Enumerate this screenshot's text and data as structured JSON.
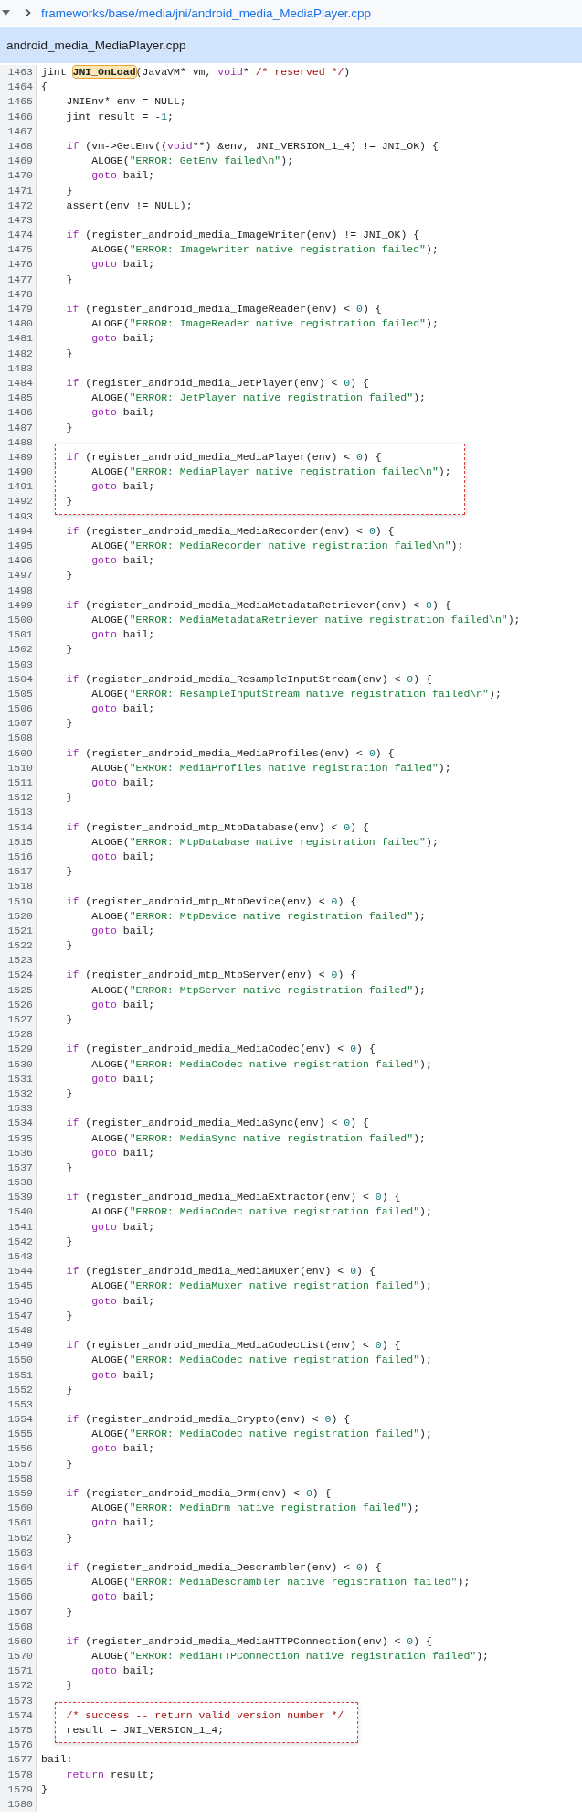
{
  "breadcrumb": {
    "path": "frameworks/base/media/jni/android_media_MediaPlayer.cpp"
  },
  "file_header": {
    "title": "android_media_MediaPlayer.cpp"
  },
  "code": {
    "segments": [
      {
        "kind": "plain",
        "lines": [
          {
            "number": "1463",
            "tokens": [
              {
                "kind": "plain",
                "text": "jint "
              },
              {
                "kind": "highlight",
                "text": "JNI_OnLoad"
              },
              {
                "kind": "plain",
                "text": "(JavaVM* vm, "
              },
              {
                "kind": "keyword",
                "text": "void"
              },
              {
                "kind": "plain",
                "text": "* "
              },
              {
                "kind": "comment",
                "text": "/* reserved */"
              },
              {
                "kind": "plain",
                "text": ")"
              }
            ]
          },
          {
            "number": "1464",
            "tokens": [
              {
                "kind": "plain",
                "text": "{"
              }
            ]
          },
          {
            "number": "1465",
            "tokens": [
              {
                "kind": "plain",
                "text": "    JNIEnv* env = NULL;"
              }
            ]
          },
          {
            "number": "1466",
            "tokens": [
              {
                "kind": "plain",
                "text": "    jint result = -"
              },
              {
                "kind": "number",
                "text": "1"
              },
              {
                "kind": "plain",
                "text": ";"
              }
            ]
          },
          {
            "number": "1467"
          },
          {
            "number": "1468",
            "tokens": [
              {
                "kind": "keyword",
                "text": "    if"
              },
              {
                "kind": "plain",
                "text": " (vm->GetEnv(("
              },
              {
                "kind": "keyword",
                "text": "void"
              },
              {
                "kind": "plain",
                "text": "**) &env, JNI_VERSION_1_4) != JNI_OK) {"
              }
            ]
          },
          {
            "number": "1469",
            "tokens": [
              {
                "kind": "plain",
                "text": "        ALOGE("
              },
              {
                "kind": "string",
                "text": "\"ERROR: GetEnv failed\\n\""
              },
              {
                "kind": "plain",
                "text": ");"
              }
            ]
          },
          {
            "number": "1470",
            "tokens": [
              {
                "kind": "keyword",
                "text": "        goto"
              },
              {
                "kind": "plain",
                "text": " bail;"
              }
            ]
          },
          {
            "number": "1471",
            "tokens": [
              {
                "kind": "plain",
                "text": "    }"
              }
            ]
          },
          {
            "number": "1472",
            "tokens": [
              {
                "kind": "plain",
                "text": "    assert(env != NULL);"
              }
            ]
          },
          {
            "number": "1473"
          },
          {
            "number": "1474",
            "tokens": [
              {
                "kind": "keyword",
                "text": "    if"
              },
              {
                "kind": "plain",
                "text": " (register_android_media_ImageWriter(env) != JNI_OK) {"
              }
            ]
          },
          {
            "number": "1475",
            "tokens": [
              {
                "kind": "plain",
                "text": "        ALOGE("
              },
              {
                "kind": "string",
                "text": "\"ERROR: ImageWriter native registration failed\""
              },
              {
                "kind": "plain",
                "text": ");"
              }
            ]
          },
          {
            "number": "1476",
            "tokens": [
              {
                "kind": "keyword",
                "text": "        goto"
              },
              {
                "kind": "plain",
                "text": " bail;"
              }
            ]
          },
          {
            "number": "1477",
            "tokens": [
              {
                "kind": "plain",
                "text": "    }"
              }
            ]
          },
          {
            "number": "1478"
          },
          {
            "number": "1479",
            "tokens": [
              {
                "kind": "keyword",
                "text": "    if"
              },
              {
                "kind": "plain",
                "text": " (register_android_media_ImageReader(env) < "
              },
              {
                "kind": "number",
                "text": "0"
              },
              {
                "kind": "plain",
                "text": ") {"
              }
            ]
          },
          {
            "number": "1480",
            "tokens": [
              {
                "kind": "plain",
                "text": "        ALOGE("
              },
              {
                "kind": "string",
                "text": "\"ERROR: ImageReader native registration failed\""
              },
              {
                "kind": "plain",
                "text": ");"
              }
            ]
          },
          {
            "number": "1481",
            "tokens": [
              {
                "kind": "keyword",
                "text": "        goto"
              },
              {
                "kind": "plain",
                "text": " bail;"
              }
            ]
          },
          {
            "number": "1482",
            "tokens": [
              {
                "kind": "plain",
                "text": "    }"
              }
            ]
          },
          {
            "number": "1483"
          },
          {
            "number": "1484",
            "tokens": [
              {
                "kind": "keyword",
                "text": "    if"
              },
              {
                "kind": "plain",
                "text": " (register_android_media_JetPlayer(env) < "
              },
              {
                "kind": "number",
                "text": "0"
              },
              {
                "kind": "plain",
                "text": ") {"
              }
            ]
          },
          {
            "number": "1485",
            "tokens": [
              {
                "kind": "plain",
                "text": "        ALOGE("
              },
              {
                "kind": "string",
                "text": "\"ERROR: JetPlayer native registration failed\""
              },
              {
                "kind": "plain",
                "text": ");"
              }
            ]
          },
          {
            "number": "1486",
            "tokens": [
              {
                "kind": "keyword",
                "text": "        goto"
              },
              {
                "kind": "plain",
                "text": " bail;"
              }
            ]
          },
          {
            "number": "1487",
            "tokens": [
              {
                "kind": "plain",
                "text": "    }"
              }
            ]
          },
          {
            "number": "1488"
          }
        ]
      },
      {
        "kind": "boxed",
        "lines": [
          {
            "number": "1489",
            "tokens": [
              {
                "kind": "keyword",
                "text": "    if"
              },
              {
                "kind": "plain",
                "text": " (register_android_media_MediaPlayer(env) < "
              },
              {
                "kind": "number",
                "text": "0"
              },
              {
                "kind": "plain",
                "text": ") {"
              }
            ]
          },
          {
            "number": "1490",
            "tokens": [
              {
                "kind": "plain",
                "text": "        ALOGE("
              },
              {
                "kind": "string",
                "text": "\"ERROR: MediaPlayer native registration failed\\n\""
              },
              {
                "kind": "plain",
                "text": ");"
              }
            ]
          },
          {
            "number": "1491",
            "tokens": [
              {
                "kind": "keyword",
                "text": "        goto"
              },
              {
                "kind": "plain",
                "text": " bail;"
              }
            ]
          },
          {
            "number": "1492",
            "tokens": [
              {
                "kind": "plain",
                "text": "    }"
              }
            ]
          }
        ]
      },
      {
        "kind": "plain",
        "lines": [
          {
            "number": "1493"
          },
          {
            "number": "1494",
            "tokens": [
              {
                "kind": "keyword",
                "text": "    if"
              },
              {
                "kind": "plain",
                "text": " (register_android_media_MediaRecorder(env) < "
              },
              {
                "kind": "number",
                "text": "0"
              },
              {
                "kind": "plain",
                "text": ") {"
              }
            ]
          },
          {
            "number": "1495",
            "tokens": [
              {
                "kind": "plain",
                "text": "        ALOGE("
              },
              {
                "kind": "string",
                "text": "\"ERROR: MediaRecorder native registration failed\\n\""
              },
              {
                "kind": "plain",
                "text": ");"
              }
            ]
          },
          {
            "number": "1496",
            "tokens": [
              {
                "kind": "keyword",
                "text": "        goto"
              },
              {
                "kind": "plain",
                "text": " bail;"
              }
            ]
          },
          {
            "number": "1497",
            "tokens": [
              {
                "kind": "plain",
                "text": "    }"
              }
            ]
          },
          {
            "number": "1498"
          },
          {
            "number": "1499",
            "tokens": [
              {
                "kind": "keyword",
                "text": "    if"
              },
              {
                "kind": "plain",
                "text": " (register_android_media_MediaMetadataRetriever(env) < "
              },
              {
                "kind": "number",
                "text": "0"
              },
              {
                "kind": "plain",
                "text": ") {"
              }
            ]
          },
          {
            "number": "1500",
            "tokens": [
              {
                "kind": "plain",
                "text": "        ALOGE("
              },
              {
                "kind": "string",
                "text": "\"ERROR: MediaMetadataRetriever native registration failed\\n\""
              },
              {
                "kind": "plain",
                "text": ");"
              }
            ]
          },
          {
            "number": "1501",
            "tokens": [
              {
                "kind": "keyword",
                "text": "        goto"
              },
              {
                "kind": "plain",
                "text": " bail;"
              }
            ]
          },
          {
            "number": "1502",
            "tokens": [
              {
                "kind": "plain",
                "text": "    }"
              }
            ]
          },
          {
            "number": "1503"
          },
          {
            "number": "1504",
            "tokens": [
              {
                "kind": "keyword",
                "text": "    if"
              },
              {
                "kind": "plain",
                "text": " (register_android_media_ResampleInputStream(env) < "
              },
              {
                "kind": "number",
                "text": "0"
              },
              {
                "kind": "plain",
                "text": ") {"
              }
            ]
          },
          {
            "number": "1505",
            "tokens": [
              {
                "kind": "plain",
                "text": "        ALOGE("
              },
              {
                "kind": "string",
                "text": "\"ERROR: ResampleInputStream native registration failed\\n\""
              },
              {
                "kind": "plain",
                "text": ");"
              }
            ]
          },
          {
            "number": "1506",
            "tokens": [
              {
                "kind": "keyword",
                "text": "        goto"
              },
              {
                "kind": "plain",
                "text": " bail;"
              }
            ]
          },
          {
            "number": "1507",
            "tokens": [
              {
                "kind": "plain",
                "text": "    }"
              }
            ]
          },
          {
            "number": "1508"
          },
          {
            "number": "1509",
            "tokens": [
              {
                "kind": "keyword",
                "text": "    if"
              },
              {
                "kind": "plain",
                "text": " (register_android_media_MediaProfiles(env) < "
              },
              {
                "kind": "number",
                "text": "0"
              },
              {
                "kind": "plain",
                "text": ") {"
              }
            ]
          },
          {
            "number": "1510",
            "tokens": [
              {
                "kind": "plain",
                "text": "        ALOGE("
              },
              {
                "kind": "string",
                "text": "\"ERROR: MediaProfiles native registration failed\""
              },
              {
                "kind": "plain",
                "text": ");"
              }
            ]
          },
          {
            "number": "1511",
            "tokens": [
              {
                "kind": "keyword",
                "text": "        goto"
              },
              {
                "kind": "plain",
                "text": " bail;"
              }
            ]
          },
          {
            "number": "1512",
            "tokens": [
              {
                "kind": "plain",
                "text": "    }"
              }
            ]
          },
          {
            "number": "1513"
          },
          {
            "number": "1514",
            "tokens": [
              {
                "kind": "keyword",
                "text": "    if"
              },
              {
                "kind": "plain",
                "text": " (register_android_mtp_MtpDatabase(env) < "
              },
              {
                "kind": "number",
                "text": "0"
              },
              {
                "kind": "plain",
                "text": ") {"
              }
            ]
          },
          {
            "number": "1515",
            "tokens": [
              {
                "kind": "plain",
                "text": "        ALOGE("
              },
              {
                "kind": "string",
                "text": "\"ERROR: MtpDatabase native registration failed\""
              },
              {
                "kind": "plain",
                "text": ");"
              }
            ]
          },
          {
            "number": "1516",
            "tokens": [
              {
                "kind": "keyword",
                "text": "        goto"
              },
              {
                "kind": "plain",
                "text": " bail;"
              }
            ]
          },
          {
            "number": "1517",
            "tokens": [
              {
                "kind": "plain",
                "text": "    }"
              }
            ]
          },
          {
            "number": "1518"
          },
          {
            "number": "1519",
            "tokens": [
              {
                "kind": "keyword",
                "text": "    if"
              },
              {
                "kind": "plain",
                "text": " (register_android_mtp_MtpDevice(env) < "
              },
              {
                "kind": "number",
                "text": "0"
              },
              {
                "kind": "plain",
                "text": ") {"
              }
            ]
          },
          {
            "number": "1520",
            "tokens": [
              {
                "kind": "plain",
                "text": "        ALOGE("
              },
              {
                "kind": "string",
                "text": "\"ERROR: MtpDevice native registration failed\""
              },
              {
                "kind": "plain",
                "text": ");"
              }
            ]
          },
          {
            "number": "1521",
            "tokens": [
              {
                "kind": "keyword",
                "text": "        goto"
              },
              {
                "kind": "plain",
                "text": " bail;"
              }
            ]
          },
          {
            "number": "1522",
            "tokens": [
              {
                "kind": "plain",
                "text": "    }"
              }
            ]
          },
          {
            "number": "1523"
          },
          {
            "number": "1524",
            "tokens": [
              {
                "kind": "keyword",
                "text": "    if"
              },
              {
                "kind": "plain",
                "text": " (register_android_mtp_MtpServer(env) < "
              },
              {
                "kind": "number",
                "text": "0"
              },
              {
                "kind": "plain",
                "text": ") {"
              }
            ]
          },
          {
            "number": "1525",
            "tokens": [
              {
                "kind": "plain",
                "text": "        ALOGE("
              },
              {
                "kind": "string",
                "text": "\"ERROR: MtpServer native registration failed\""
              },
              {
                "kind": "plain",
                "text": ");"
              }
            ]
          },
          {
            "number": "1526",
            "tokens": [
              {
                "kind": "keyword",
                "text": "        goto"
              },
              {
                "kind": "plain",
                "text": " bail;"
              }
            ]
          },
          {
            "number": "1527",
            "tokens": [
              {
                "kind": "plain",
                "text": "    }"
              }
            ]
          },
          {
            "number": "1528"
          },
          {
            "number": "1529",
            "tokens": [
              {
                "kind": "keyword",
                "text": "    if"
              },
              {
                "kind": "plain",
                "text": " (register_android_media_MediaCodec(env) < "
              },
              {
                "kind": "number",
                "text": "0"
              },
              {
                "kind": "plain",
                "text": ") {"
              }
            ]
          },
          {
            "number": "1530",
            "tokens": [
              {
                "kind": "plain",
                "text": "        ALOGE("
              },
              {
                "kind": "string",
                "text": "\"ERROR: MediaCodec native registration failed\""
              },
              {
                "kind": "plain",
                "text": ");"
              }
            ]
          },
          {
            "number": "1531",
            "tokens": [
              {
                "kind": "keyword",
                "text": "        goto"
              },
              {
                "kind": "plain",
                "text": " bail;"
              }
            ]
          },
          {
            "number": "1532",
            "tokens": [
              {
                "kind": "plain",
                "text": "    }"
              }
            ]
          },
          {
            "number": "1533"
          },
          {
            "number": "1534",
            "tokens": [
              {
                "kind": "keyword",
                "text": "    if"
              },
              {
                "kind": "plain",
                "text": " (register_android_media_MediaSync(env) < "
              },
              {
                "kind": "number",
                "text": "0"
              },
              {
                "kind": "plain",
                "text": ") {"
              }
            ]
          },
          {
            "number": "1535",
            "tokens": [
              {
                "kind": "plain",
                "text": "        ALOGE("
              },
              {
                "kind": "string",
                "text": "\"ERROR: MediaSync native registration failed\""
              },
              {
                "kind": "plain",
                "text": ");"
              }
            ]
          },
          {
            "number": "1536",
            "tokens": [
              {
                "kind": "keyword",
                "text": "        goto"
              },
              {
                "kind": "plain",
                "text": " bail;"
              }
            ]
          },
          {
            "number": "1537",
            "tokens": [
              {
                "kind": "plain",
                "text": "    }"
              }
            ]
          },
          {
            "number": "1538"
          },
          {
            "number": "1539",
            "tokens": [
              {
                "kind": "keyword",
                "text": "    if"
              },
              {
                "kind": "plain",
                "text": " (register_android_media_MediaExtractor(env) < "
              },
              {
                "kind": "number",
                "text": "0"
              },
              {
                "kind": "plain",
                "text": ") {"
              }
            ]
          },
          {
            "number": "1540",
            "tokens": [
              {
                "kind": "plain",
                "text": "        ALOGE("
              },
              {
                "kind": "string",
                "text": "\"ERROR: MediaCodec native registration failed\""
              },
              {
                "kind": "plain",
                "text": ");"
              }
            ]
          },
          {
            "number": "1541",
            "tokens": [
              {
                "kind": "keyword",
                "text": "        goto"
              },
              {
                "kind": "plain",
                "text": " bail;"
              }
            ]
          },
          {
            "number": "1542",
            "tokens": [
              {
                "kind": "plain",
                "text": "    }"
              }
            ]
          },
          {
            "number": "1543"
          },
          {
            "number": "1544",
            "tokens": [
              {
                "kind": "keyword",
                "text": "    if"
              },
              {
                "kind": "plain",
                "text": " (register_android_media_MediaMuxer(env) < "
              },
              {
                "kind": "number",
                "text": "0"
              },
              {
                "kind": "plain",
                "text": ") {"
              }
            ]
          },
          {
            "number": "1545",
            "tokens": [
              {
                "kind": "plain",
                "text": "        ALOGE("
              },
              {
                "kind": "string",
                "text": "\"ERROR: MediaMuxer native registration failed\""
              },
              {
                "kind": "plain",
                "text": ");"
              }
            ]
          },
          {
            "number": "1546",
            "tokens": [
              {
                "kind": "keyword",
                "text": "        goto"
              },
              {
                "kind": "plain",
                "text": " bail;"
              }
            ]
          },
          {
            "number": "1547",
            "tokens": [
              {
                "kind": "plain",
                "text": "    }"
              }
            ]
          },
          {
            "number": "1548"
          },
          {
            "number": "1549",
            "tokens": [
              {
                "kind": "keyword",
                "text": "    if"
              },
              {
                "kind": "plain",
                "text": " (register_android_media_MediaCodecList(env) < "
              },
              {
                "kind": "number",
                "text": "0"
              },
              {
                "kind": "plain",
                "text": ") {"
              }
            ]
          },
          {
            "number": "1550",
            "tokens": [
              {
                "kind": "plain",
                "text": "        ALOGE("
              },
              {
                "kind": "string",
                "text": "\"ERROR: MediaCodec native registration failed\""
              },
              {
                "kind": "plain",
                "text": ");"
              }
            ]
          },
          {
            "number": "1551",
            "tokens": [
              {
                "kind": "keyword",
                "text": "        goto"
              },
              {
                "kind": "plain",
                "text": " bail;"
              }
            ]
          },
          {
            "number": "1552",
            "tokens": [
              {
                "kind": "plain",
                "text": "    }"
              }
            ]
          },
          {
            "number": "1553"
          },
          {
            "number": "1554",
            "tokens": [
              {
                "kind": "keyword",
                "text": "    if"
              },
              {
                "kind": "plain",
                "text": " (register_android_media_Crypto(env) < "
              },
              {
                "kind": "number",
                "text": "0"
              },
              {
                "kind": "plain",
                "text": ") {"
              }
            ]
          },
          {
            "number": "1555",
            "tokens": [
              {
                "kind": "plain",
                "text": "        ALOGE("
              },
              {
                "kind": "string",
                "text": "\"ERROR: MediaCodec native registration failed\""
              },
              {
                "kind": "plain",
                "text": ");"
              }
            ]
          },
          {
            "number": "1556",
            "tokens": [
              {
                "kind": "keyword",
                "text": "        goto"
              },
              {
                "kind": "plain",
                "text": " bail;"
              }
            ]
          },
          {
            "number": "1557",
            "tokens": [
              {
                "kind": "plain",
                "text": "    }"
              }
            ]
          },
          {
            "number": "1558"
          },
          {
            "number": "1559",
            "tokens": [
              {
                "kind": "keyword",
                "text": "    if"
              },
              {
                "kind": "plain",
                "text": " (register_android_media_Drm(env) < "
              },
              {
                "kind": "number",
                "text": "0"
              },
              {
                "kind": "plain",
                "text": ") {"
              }
            ]
          },
          {
            "number": "1560",
            "tokens": [
              {
                "kind": "plain",
                "text": "        ALOGE("
              },
              {
                "kind": "string",
                "text": "\"ERROR: MediaDrm native registration failed\""
              },
              {
                "kind": "plain",
                "text": ");"
              }
            ]
          },
          {
            "number": "1561",
            "tokens": [
              {
                "kind": "keyword",
                "text": "        goto"
              },
              {
                "kind": "plain",
                "text": " bail;"
              }
            ]
          },
          {
            "number": "1562",
            "tokens": [
              {
                "kind": "plain",
                "text": "    }"
              }
            ]
          },
          {
            "number": "1563"
          },
          {
            "number": "1564",
            "tokens": [
              {
                "kind": "keyword",
                "text": "    if"
              },
              {
                "kind": "plain",
                "text": " (register_android_media_Descrambler(env) < "
              },
              {
                "kind": "number",
                "text": "0"
              },
              {
                "kind": "plain",
                "text": ") {"
              }
            ]
          },
          {
            "number": "1565",
            "tokens": [
              {
                "kind": "plain",
                "text": "        ALOGE("
              },
              {
                "kind": "string",
                "text": "\"ERROR: MediaDescrambler native registration failed\""
              },
              {
                "kind": "plain",
                "text": ");"
              }
            ]
          },
          {
            "number": "1566",
            "tokens": [
              {
                "kind": "keyword",
                "text": "        goto"
              },
              {
                "kind": "plain",
                "text": " bail;"
              }
            ]
          },
          {
            "number": "1567",
            "tokens": [
              {
                "kind": "plain",
                "text": "    }"
              }
            ]
          },
          {
            "number": "1568"
          },
          {
            "number": "1569",
            "tokens": [
              {
                "kind": "keyword",
                "text": "    if"
              },
              {
                "kind": "plain",
                "text": " (register_android_media_MediaHTTPConnection(env) < "
              },
              {
                "kind": "number",
                "text": "0"
              },
              {
                "kind": "plain",
                "text": ") {"
              }
            ]
          },
          {
            "number": "1570",
            "tokens": [
              {
                "kind": "plain",
                "text": "        ALOGE("
              },
              {
                "kind": "string",
                "text": "\"ERROR: MediaHTTPConnection native registration failed\""
              },
              {
                "kind": "plain",
                "text": ");"
              }
            ]
          },
          {
            "number": "1571",
            "tokens": [
              {
                "kind": "keyword",
                "text": "        goto"
              },
              {
                "kind": "plain",
                "text": " bail;"
              }
            ]
          },
          {
            "number": "1572",
            "tokens": [
              {
                "kind": "plain",
                "text": "    }"
              }
            ]
          },
          {
            "number": "1573"
          }
        ]
      },
      {
        "kind": "boxed",
        "lines": [
          {
            "number": "1574",
            "tokens": [
              {
                "kind": "comment",
                "text": "    /* success -- return valid version number */"
              }
            ]
          },
          {
            "number": "1575",
            "tokens": [
              {
                "kind": "plain",
                "text": "    result = JNI_VERSION_1_4;"
              }
            ]
          }
        ]
      },
      {
        "kind": "plain",
        "lines": [
          {
            "number": "1576"
          },
          {
            "number": "1577",
            "tokens": [
              {
                "kind": "plain",
                "text": "bail:"
              }
            ]
          },
          {
            "number": "1578",
            "tokens": [
              {
                "kind": "keyword",
                "text": "    return"
              },
              {
                "kind": "plain",
                "text": " result;"
              }
            ]
          },
          {
            "number": "1579",
            "tokens": [
              {
                "kind": "plain",
                "text": "}"
              }
            ]
          },
          {
            "number": "1580"
          }
        ]
      }
    ]
  }
}
